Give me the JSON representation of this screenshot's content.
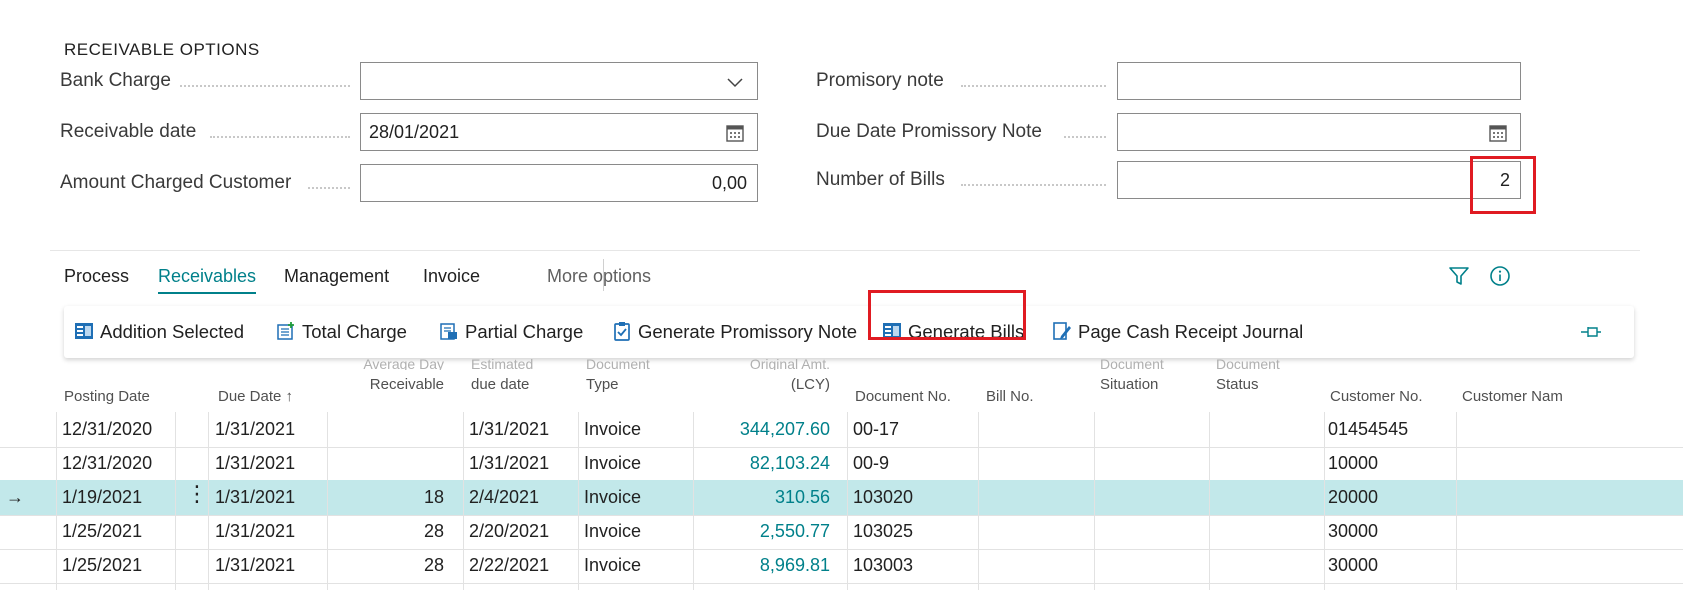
{
  "section": {
    "title": "RECEIVABLE OPTIONS"
  },
  "fields": {
    "bank_charge": {
      "label": "Bank Charge",
      "value": ""
    },
    "receivable_date": {
      "label": "Receivable date",
      "value": "28/01/2021"
    },
    "amount_charged": {
      "label": "Amount Charged Customer",
      "value": "0,00"
    },
    "promisory_note": {
      "label": "Promisory note",
      "value": ""
    },
    "due_date_promissory": {
      "label": "Due Date Promissory Note",
      "value": ""
    },
    "number_of_bills": {
      "label": "Number of Bills",
      "value": "2"
    }
  },
  "tabs": [
    {
      "label": "Process"
    },
    {
      "label": "Receivables"
    },
    {
      "label": "Management"
    },
    {
      "label": "Invoice"
    },
    {
      "label": "More options"
    }
  ],
  "actions": [
    {
      "label": "Addition Selected"
    },
    {
      "label": "Total Charge"
    },
    {
      "label": "Partial Charge"
    },
    {
      "label": "Generate Promissory Note"
    },
    {
      "label": "Generate Bills"
    },
    {
      "label": "Page Cash Receipt Journal"
    }
  ],
  "table": {
    "headers": {
      "posting_date": "Posting Date",
      "due_date": "Due Date ↑",
      "avg_day_1": "Average Day",
      "avg_day_2": "Receivable",
      "est_1": "Estimated",
      "est_2": "due date",
      "doc_type_1": "Document",
      "doc_type_2": "Type",
      "orig_amt_1": "Original Amt.",
      "orig_amt_2": "(LCY)",
      "doc_no": "Document No.",
      "bill_no": "Bill No.",
      "doc_sit_1": "Document",
      "doc_sit_2": "Situation",
      "doc_status_1": "Document",
      "doc_status_2": "Status",
      "customer_no": "Customer No.",
      "customer_name": "Customer Nam"
    },
    "rows": [
      {
        "posting_date": "12/31/2020",
        "due_date": "1/31/2021",
        "avg_day": "",
        "est_due": "1/31/2021",
        "doc_type": "Invoice",
        "orig_amt": "344,207.60",
        "doc_no": "00-17",
        "customer_no": "01454545"
      },
      {
        "posting_date": "12/31/2020",
        "due_date": "1/31/2021",
        "avg_day": "",
        "est_due": "1/31/2021",
        "doc_type": "Invoice",
        "orig_amt": "82,103.24",
        "doc_no": "00-9",
        "customer_no": "10000"
      },
      {
        "posting_date": "1/19/2021",
        "due_date": "1/31/2021",
        "avg_day": "18",
        "est_due": "2/4/2021",
        "doc_type": "Invoice",
        "orig_amt": "310.56",
        "doc_no": "103020",
        "customer_no": "20000"
      },
      {
        "posting_date": "1/25/2021",
        "due_date": "1/31/2021",
        "avg_day": "28",
        "est_due": "2/20/2021",
        "doc_type": "Invoice",
        "orig_amt": "2,550.77",
        "doc_no": "103025",
        "customer_no": "30000"
      },
      {
        "posting_date": "1/25/2021",
        "due_date": "1/31/2021",
        "avg_day": "28",
        "est_due": "2/22/2021",
        "doc_type": "Invoice",
        "orig_amt": "8,969.81",
        "doc_no": "103003",
        "customer_no": "30000"
      }
    ],
    "row_menu_glyph": "⋮",
    "current_row_glyph": "→"
  },
  "colors": {
    "accent": "#00808a",
    "selected_row": "#c2e8ea",
    "highlight": "#e01b22"
  },
  "icons": [
    "chevron-down-icon",
    "calendar-icon",
    "filter-icon",
    "info-icon",
    "pin-icon"
  ]
}
